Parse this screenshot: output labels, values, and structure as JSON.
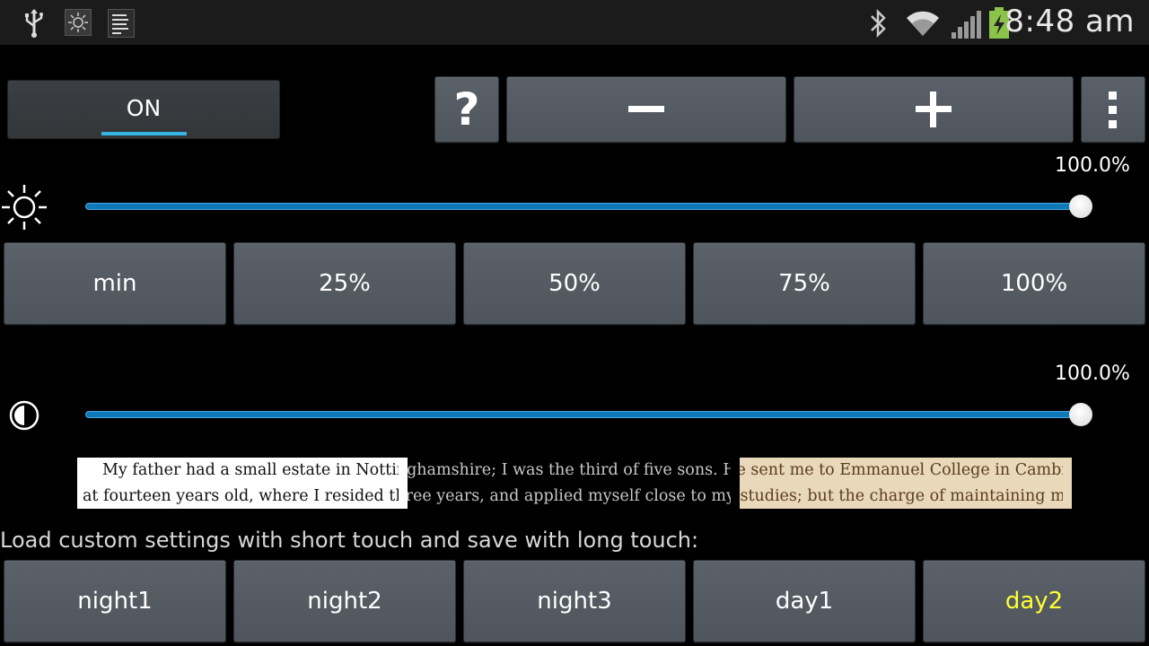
{
  "status_bar": {
    "left_icons": [
      "usb-icon",
      "brightness-notification-icon",
      "notes-icon"
    ],
    "right_icons": [
      "bluetooth-icon",
      "wifi-icon",
      "signal-icon",
      "battery-charging-icon"
    ],
    "time": "8:48 am"
  },
  "toolbar": {
    "toggle_label": "ON",
    "help_label": "?",
    "minus_label": "−",
    "plus_label": "+",
    "overflow_icon": "more-vert-icon"
  },
  "brightness": {
    "icon": "sun-icon",
    "percent_label": "100.0%",
    "value_percent": 100
  },
  "presets": [
    "min",
    "25%",
    "50%",
    "75%",
    "100%"
  ],
  "contrast": {
    "icon": "contrast-icon",
    "percent_label": "100.0%",
    "value_percent": 100
  },
  "sample": {
    "line1": "My father had a small estate in Nottinghamshire; I was the third of five sons. He sent me to Emmanuel College in Cambridge",
    "line2": "at fourteen years old, where I resided three years, and applied myself close to my studies; but the charge of maintaining me,"
  },
  "custom": {
    "label": "Load custom settings with short touch and save with long touch:",
    "buttons": [
      "night1",
      "night2",
      "night3",
      "day1",
      "day2"
    ],
    "highlight_color": "#ffff33"
  },
  "colors": {
    "accent": "#33b5e5",
    "slider": "#0f78b8"
  }
}
